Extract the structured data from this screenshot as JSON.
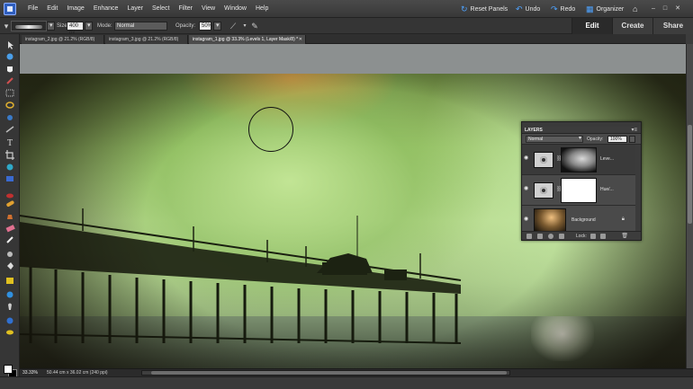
{
  "menu": {
    "items": [
      "File",
      "Edit",
      "Image",
      "Enhance",
      "Layer",
      "Select",
      "Filter",
      "View",
      "Window",
      "Help"
    ]
  },
  "top_actions": {
    "reset_panels": "Reset Panels",
    "undo": "Undo",
    "redo": "Redo",
    "organizer": "Organizer"
  },
  "options": {
    "size_label": "Size:",
    "size_value": "400 px",
    "mode_label": "Mode:",
    "mode_value": "Normal",
    "opacity_label": "Opacity:",
    "opacity_value": "50%"
  },
  "mode_tabs": [
    "Edit",
    "Create",
    "Share"
  ],
  "doc_tabs": [
    "instagram_2.jpg @ 21.2% (RGB/8)",
    "instagram_3.jpg @ 21.2% (RGB/8)",
    "instagram_1.jpg @ 33.3% (Levels 1, Layer Mask/8) *"
  ],
  "status": {
    "zoom": "33.33%",
    "doc_size": "50.44 cm x 36.02 cm (240 ppi)"
  },
  "layers": {
    "title": "LAYERS",
    "blend_mode": "Normal",
    "opacity_label": "Opacity:",
    "opacity_value": "100%",
    "lock_label": "Lock:",
    "rows": [
      {
        "name": "Leve..."
      },
      {
        "name": "Hue/..."
      },
      {
        "name": "Background"
      }
    ]
  },
  "colors": {
    "accent": "#4ea3ff",
    "panel_bg": "#505050",
    "toolbar_bg": "#363636"
  }
}
